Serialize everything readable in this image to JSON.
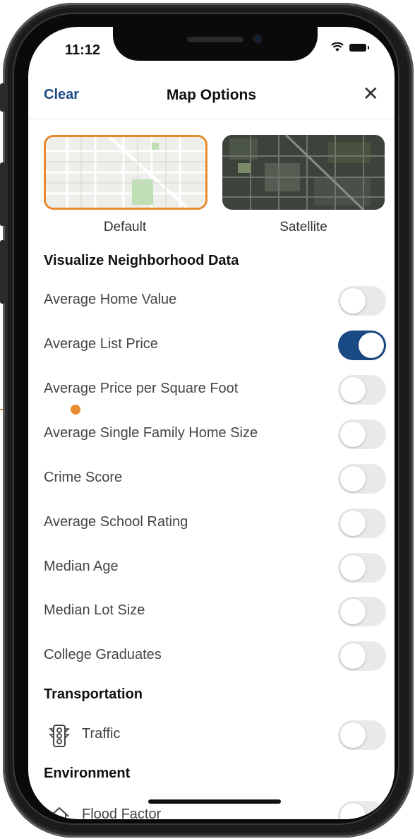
{
  "status_bar": {
    "time": "11:12"
  },
  "header": {
    "clear_label": "Clear",
    "title": "Map Options",
    "close_label": "✕"
  },
  "map_types": [
    {
      "label": "Default",
      "selected": true
    },
    {
      "label": "Satellite",
      "selected": false
    }
  ],
  "sections": {
    "neighborhood": {
      "title": "Visualize Neighborhood Data",
      "items": [
        {
          "label": "Average Home Value",
          "on": false
        },
        {
          "label": "Average List Price",
          "on": true
        },
        {
          "label": "Average Price per Square Foot",
          "on": false
        },
        {
          "label": "Average Single Family Home Size",
          "on": false
        },
        {
          "label": "Crime Score",
          "on": false
        },
        {
          "label": "Average School Rating",
          "on": false
        },
        {
          "label": "Median Age",
          "on": false
        },
        {
          "label": "Median Lot Size",
          "on": false
        },
        {
          "label": "College Graduates",
          "on": false
        }
      ]
    },
    "transportation": {
      "title": "Transportation",
      "items": [
        {
          "label": "Traffic",
          "icon": "traffic-light-icon",
          "on": false
        }
      ]
    },
    "environment": {
      "title": "Environment",
      "items": [
        {
          "label": "Flood Factor",
          "icon": "house-icon",
          "on": false
        }
      ]
    }
  },
  "colors": {
    "accent": "#1a4a84",
    "selection": "#e88a2e",
    "toggle_off": "#e9e9e9"
  }
}
